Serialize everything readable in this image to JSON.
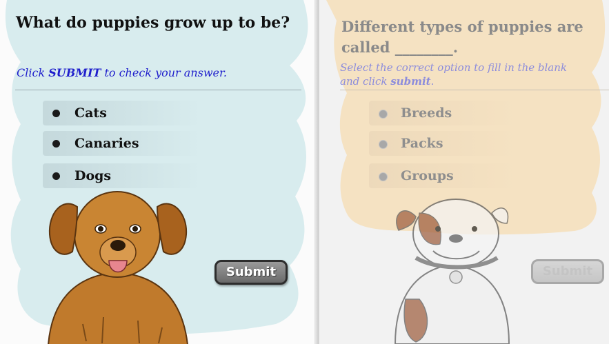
{
  "left_quiz": {
    "question": "What do puppies grow up to be?",
    "instruction_prefix": "Click ",
    "instruction_emphasis": "SUBMIT",
    "instruction_suffix": " to check your answer.",
    "options": [
      {
        "label": "Cats"
      },
      {
        "label": "Canaries"
      },
      {
        "label": "Dogs"
      }
    ],
    "submit_label": "Submit",
    "colors": {
      "blob": "#d8ecee",
      "instruction": "#1f1fcc",
      "text": "#111111"
    }
  },
  "right_quiz": {
    "question_line1": "Different types of puppies are",
    "question_line2": "called ________.",
    "instruction_line1": "Select the correct option to fill in the blank",
    "instruction_line2_prefix": "and click ",
    "instruction_emphasis": "submit",
    "instruction_line2_suffix": ".",
    "options": [
      {
        "label": "Breeds"
      },
      {
        "label": "Packs"
      },
      {
        "label": "Groups"
      }
    ],
    "submit_label": "Submit",
    "colors": {
      "blob": "#f5e2c2",
      "instruction": "#8c8cdc",
      "text": "#8a8a8a"
    }
  }
}
